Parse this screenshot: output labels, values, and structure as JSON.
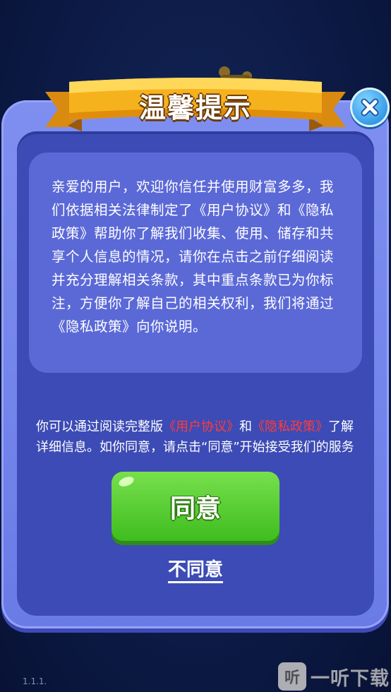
{
  "dialog": {
    "title": "温馨提示",
    "body": "亲爱的用户，欢迎你信任并使用财富多多，我们依据相关法律制定了《用户协议》和《隐私政策》帮助你了解我们收集、使用、储存和共享个人信息的情况，请你在点击之前仔细阅读并充分理解相关条款，其中重点条款已为你标注，方便你了解自己的相关权利，我们将通过《隐私政策》向你说明。",
    "info": {
      "prefix": "你可以通过阅读完整版",
      "link_user_agreement": "《用户协议》",
      "mid": "和",
      "link_privacy_policy": "《隐私政策》",
      "suffix": "了解详细信息。如你同意，请点击“同意”开始接受我们的服务"
    },
    "agree_label": "同意",
    "disagree_label": "不同意",
    "close_icon": "close-icon"
  },
  "footer": {
    "version": "1.1.1.",
    "watermark_logo": "听",
    "watermark_text": "一听下载"
  },
  "colors": {
    "background": "#0c1a45",
    "dialog_frame": "#7383ea",
    "dialog_panel": "#3c4bb5",
    "text_card": "#5b69d7",
    "link_red": "#ff3b3b",
    "agree_green": "#4fcb2a",
    "ribbon_gold": "#f6b21d",
    "close_blue": "#3aa0ec"
  }
}
